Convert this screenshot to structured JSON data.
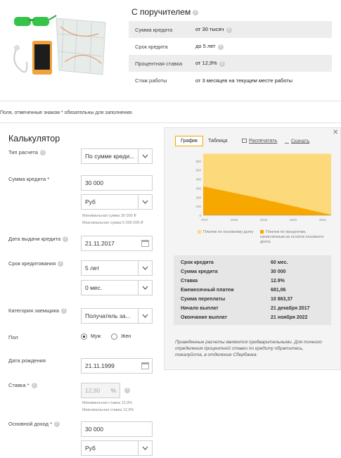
{
  "product": {
    "title": "С поручителем",
    "params": [
      {
        "label": "Сумма кредита",
        "value": "от 30 тысяч"
      },
      {
        "label": "Срок кредита",
        "value": "до 5 лет"
      },
      {
        "label": "Процентная ставка",
        "value": "от 12,9%"
      },
      {
        "label": "Стаж работы",
        "value": "от 3 месяцев на текущем месте работы"
      }
    ]
  },
  "required_note": "Поля, отмеченные знаком * обязательны для заполнения.",
  "calculator": {
    "title": "Калькулятор",
    "calc_type_label": "Тип расчета",
    "calc_type_value": "По сумме креди...",
    "amount_label": "Сумма кредита *",
    "amount_value": "30 000",
    "currency_value": "Руб",
    "amount_hint_min": "Минимальная сумма 30 000 ₽",
    "amount_hint_max": "Максимальная сумма 5 000 000 ₽",
    "issue_date_label": "Дата выдачи кредита",
    "issue_date_value": "21.11.2017",
    "term_label": "Срок кредитования",
    "term_years_value": "5 лет",
    "term_months_value": "0 мес.",
    "borrower_label": "Категория заемщика",
    "borrower_value": "Получатель за...",
    "gender_label": "Пол",
    "gender_male": "Муж",
    "gender_female": "Жен",
    "birth_label": "Дата рождения",
    "birth_value": "21.11.1999",
    "rate_label": "Ставка *",
    "rate_value": "12,90",
    "rate_unit": "%",
    "rate_hint_min": "Минимальная ставка 12,9%",
    "rate_hint_max": "Максимальная ставка 12,9%",
    "income_label": "Основной доход *",
    "income_value": "30 000",
    "income_currency": "Руб"
  },
  "panel": {
    "tabs": {
      "chart": "График",
      "table": "Таблица",
      "print": "Распечатать",
      "download": "Скачать"
    },
    "legend": {
      "principal": "Платеж по основному долгу",
      "interest": "Платеж по процентам, начисленным на остаток основного долга."
    },
    "summary": [
      {
        "label": "Срок кредита",
        "value": "60 мес."
      },
      {
        "label": "Сумма кредита",
        "value": "30 000"
      },
      {
        "label": "Ставка",
        "value": "12.9%"
      },
      {
        "label": "Ежемесячный платеж",
        "value": "681,06"
      },
      {
        "label": "Сумма переплаты",
        "value": "10 863,37"
      },
      {
        "label": "Начало выплат",
        "value": "21 декабря 2017"
      },
      {
        "label": "Окончание выплат",
        "value": "21 ноября 2022"
      }
    ],
    "disclaimer": "Приведенные расчеты являются предварительными. Для точного определения процентной ставки по кредиту обратитесь, пожалуйста, в отделение Сбербанка."
  },
  "chart_data": {
    "type": "area",
    "x": [
      "2017",
      "2018",
      "2019",
      "2020",
      "2021"
    ],
    "y_ticks": [
      "0",
      "100",
      "200",
      "300",
      "400",
      "500",
      "600"
    ],
    "ylim": [
      0,
      700
    ],
    "series": [
      {
        "name": "Платеж по основному долгу",
        "color": "#fcd97a",
        "values": [
          681,
          681,
          681,
          681,
          681,
          681
        ]
      },
      {
        "name": "Платеж по процентам, начисленным на остаток основного долга.",
        "color": "#f7a800",
        "values": [
          320,
          260,
          200,
          135,
          70,
          5
        ]
      }
    ]
  },
  "colors": {
    "accent": "#f0a800",
    "principal": "#fcd97a",
    "interest": "#f7a800"
  }
}
